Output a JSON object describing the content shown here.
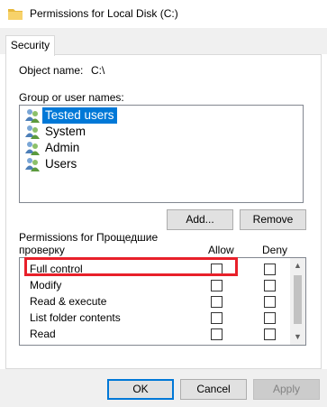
{
  "window": {
    "title": "Permissions for Local Disk (C:)",
    "icon": "folder-icon"
  },
  "tabs": [
    {
      "label": "Security",
      "selected": true
    }
  ],
  "object": {
    "label": "Object name:",
    "value": "C:\\"
  },
  "groups": {
    "label": "Group or user names:",
    "items": [
      {
        "label": "Tested users",
        "icon": "users-group-icon",
        "selected": true
      },
      {
        "label": "System",
        "icon": "users-group-icon",
        "selected": false
      },
      {
        "label": "Admin",
        "icon": "users-group-icon",
        "selected": false
      },
      {
        "label": "Users",
        "icon": "users-group-icon",
        "selected": false
      }
    ]
  },
  "buttons": {
    "add": "Add...",
    "remove": "Remove",
    "ok": "OK",
    "cancel": "Cancel",
    "apply": "Apply"
  },
  "permissions": {
    "title_line1": "Permissions for Прощедшие",
    "title_line2": "проверку",
    "allow_header": "Allow",
    "deny_header": "Deny",
    "rows": [
      {
        "name": "Full control",
        "allow": false,
        "deny": false,
        "highlighted": true
      },
      {
        "name": "Modify",
        "allow": false,
        "deny": false
      },
      {
        "name": "Read & execute",
        "allow": false,
        "deny": false
      },
      {
        "name": "List folder contents",
        "allow": false,
        "deny": false
      },
      {
        "name": "Read",
        "allow": false,
        "deny": false
      }
    ]
  },
  "colors": {
    "selection": "#0078d7",
    "highlight_box": "#e8202a"
  }
}
